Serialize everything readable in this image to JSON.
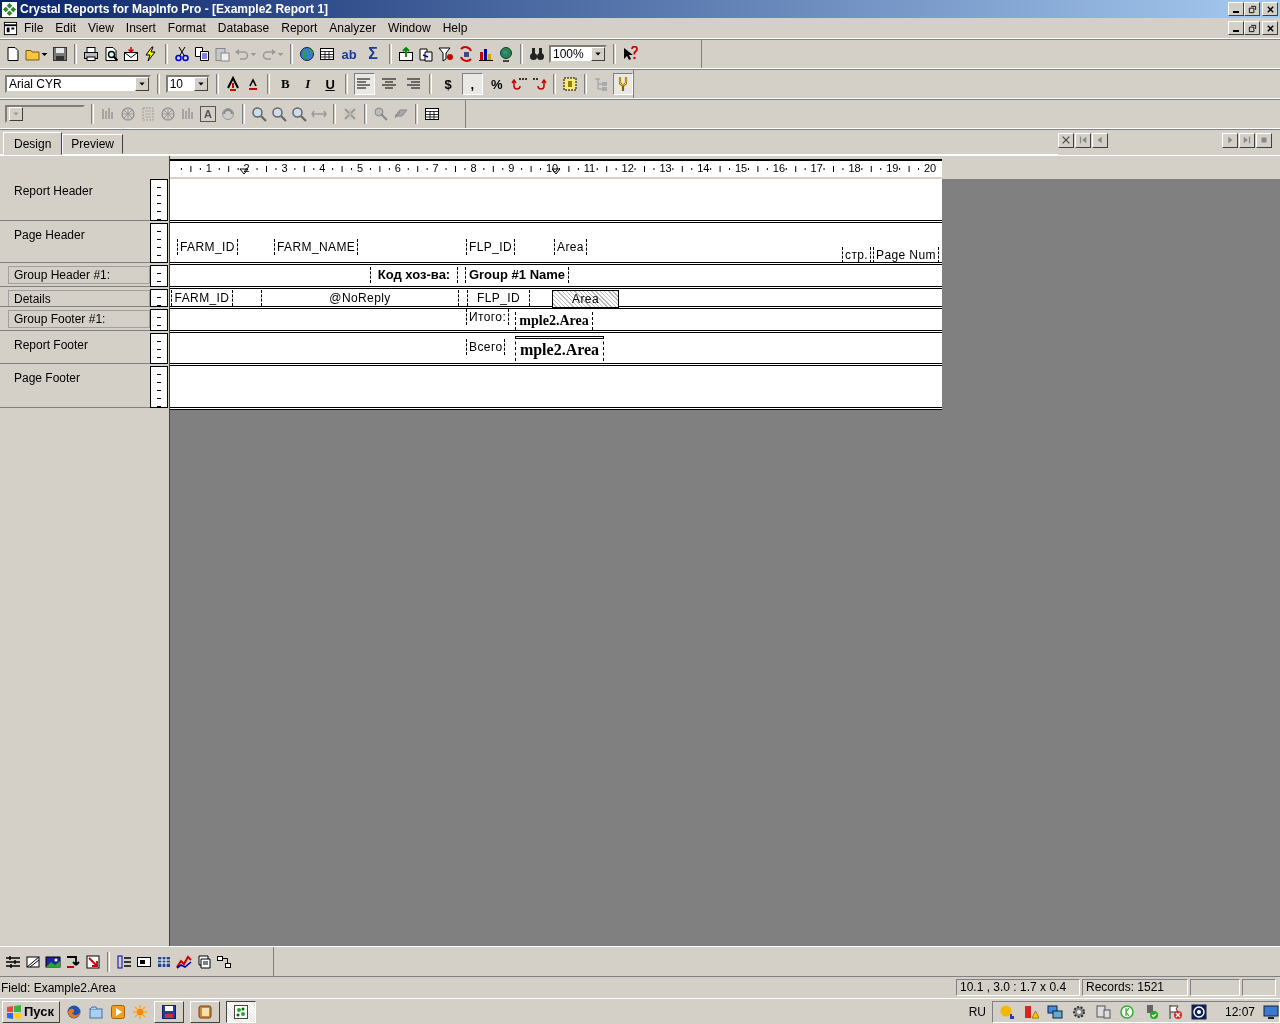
{
  "window": {
    "title": "Crystal Reports for MapInfo Pro - [Example2 Report 1]"
  },
  "menu": [
    "File",
    "Edit",
    "View",
    "Insert",
    "Format",
    "Database",
    "Report",
    "Analyzer",
    "Window",
    "Help"
  ],
  "standard_toolbar": {
    "field_button": "ab",
    "summary_button": "Σ",
    "zoom": "100%"
  },
  "format_toolbar": {
    "font": "Arial CYR",
    "size": "10",
    "styles": [
      {
        "label": "B",
        "on": false
      },
      {
        "label": "I",
        "on": false
      },
      {
        "label": "U",
        "on": false
      }
    ],
    "alignment": [
      {
        "selected": true
      },
      {
        "selected": false
      },
      {
        "selected": false
      }
    ],
    "number_formats": [
      {
        "label": "$",
        "on": false
      },
      {
        "label": ",",
        "on": true
      },
      {
        "label": "%",
        "on": false
      }
    ],
    "last_tool_on": true
  },
  "insert_toolbar": {
    "text_object": "A"
  },
  "tabs": [
    {
      "label": "Design",
      "selected": true
    },
    {
      "label": "Preview",
      "selected": false
    }
  ],
  "ruler": [
    "1",
    "2",
    "3",
    "4",
    "5",
    "6",
    "7",
    "8",
    "9",
    "10",
    "11",
    "12",
    "13",
    "14",
    "15",
    "16",
    "17",
    "18",
    "19",
    "20"
  ],
  "sections": [
    {
      "name": "Report Header",
      "boxed": false
    },
    {
      "name": "Page Header",
      "boxed": false,
      "fields": [
        {
          "text": "FARM_ID",
          "kind": "text",
          "selected": false
        },
        {
          "text": "FARM_NAME",
          "kind": "text",
          "selected": false
        },
        {
          "text": "FLP_ID",
          "kind": "text",
          "selected": false
        },
        {
          "text": "Area",
          "kind": "text",
          "selected": false
        },
        {
          "text": "стр.",
          "kind": "text",
          "selected": false
        },
        {
          "text": "Page Num",
          "kind": "text",
          "selected": false
        }
      ]
    },
    {
      "name": "Group Header #1:",
      "boxed": true,
      "fields": [
        {
          "text": "Код хоз-ва:",
          "kind": "heading",
          "selected": false
        },
        {
          "text": "Group #1 Name",
          "kind": "heading",
          "selected": false
        }
      ]
    },
    {
      "name": "Details",
      "boxed": true,
      "fields": [
        {
          "text": "FARM_ID",
          "kind": "text",
          "selected": false
        },
        {
          "text": "@NoReply",
          "kind": "text",
          "selected": false
        },
        {
          "text": "FLP_ID",
          "kind": "text",
          "selected": false
        },
        {
          "text": "Area",
          "kind": "text",
          "selected": true
        }
      ]
    },
    {
      "name": "Group Footer #1:",
      "boxed": true,
      "fields": [
        {
          "text": "Итого:",
          "kind": "text",
          "selected": false
        },
        {
          "text": "mple2.Area",
          "kind": "summary",
          "selected": false
        }
      ]
    },
    {
      "name": "Report Footer",
      "boxed": false,
      "fields": [
        {
          "text": "Всего",
          "kind": "text",
          "selected": false
        },
        {
          "text": "mple2.Area",
          "kind": "total",
          "selected": false
        }
      ]
    },
    {
      "name": "Page Footer",
      "boxed": false
    }
  ],
  "status_bar": {
    "message": "Field: Example2.Area",
    "position": "10.1 , 3.0 : 1.7 x 0.4",
    "records": "Records:  1521"
  },
  "taskbar": {
    "start": "Пуск",
    "tasks": [
      {
        "selected": false
      },
      {
        "selected": false
      },
      {
        "selected": true
      }
    ],
    "language": "RU",
    "clock": "12:07"
  }
}
